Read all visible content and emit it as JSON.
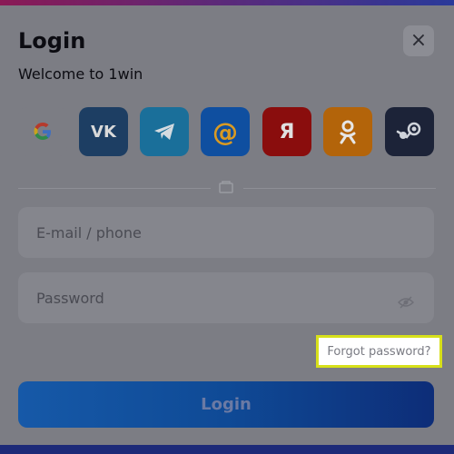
{
  "modal": {
    "title": "Login",
    "subtitle": "Welcome to 1win",
    "close_icon": "close-icon"
  },
  "social_login": [
    {
      "name": "google",
      "icon": "google-icon",
      "label": "G",
      "color": "#7c7d84"
    },
    {
      "name": "vk",
      "icon": "vk-icon",
      "label": "VK",
      "color": "#1d3e63"
    },
    {
      "name": "telegram",
      "icon": "telegram-icon",
      "label": "➤",
      "color": "#1a6f9a"
    },
    {
      "name": "mail",
      "icon": "mail-at-icon",
      "label": "@",
      "color": "#0f4fa0"
    },
    {
      "name": "yandex",
      "icon": "yandex-icon",
      "label": "Я",
      "color": "#8a0d0d"
    },
    {
      "name": "odnoklassniki",
      "icon": "odnoklassniki-icon",
      "label": "ОК",
      "color": "#b3640a"
    },
    {
      "name": "steam",
      "icon": "steam-icon",
      "label": "⬤",
      "color": "#1c2338"
    }
  ],
  "form": {
    "email_placeholder": "E-mail / phone",
    "password_placeholder": "Password",
    "forgot_password_label": "Forgot password?",
    "login_button_label": "Login"
  }
}
